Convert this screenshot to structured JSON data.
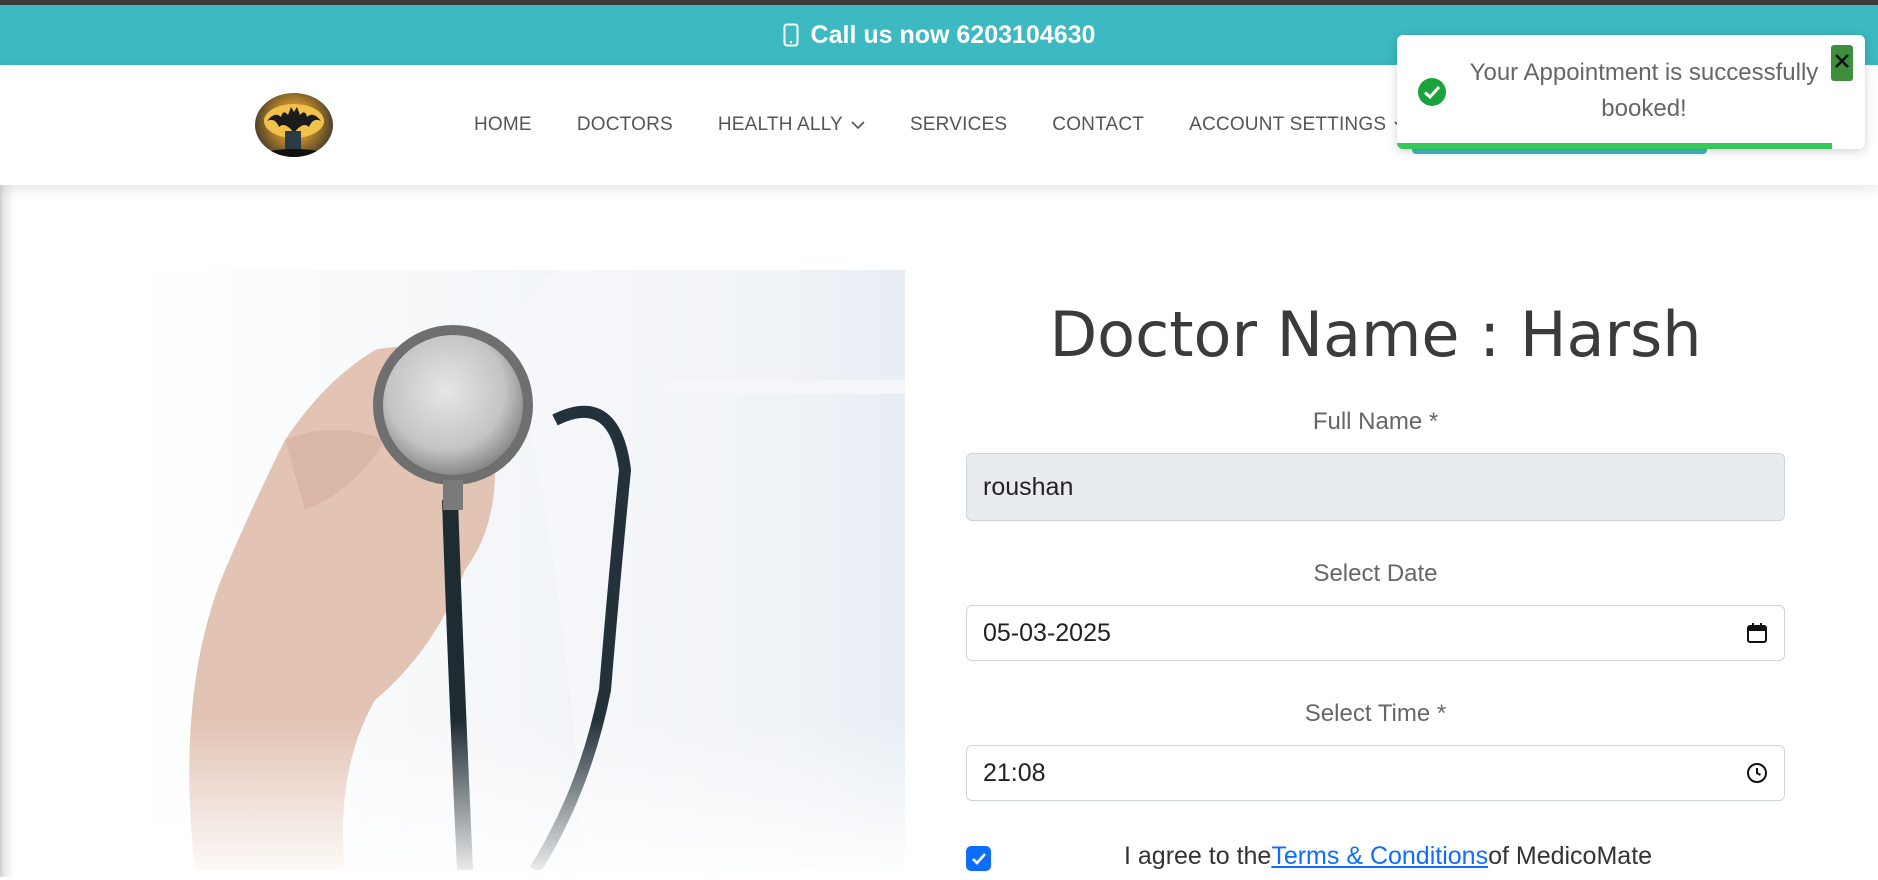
{
  "topbar": {
    "phone_text": "Call us now 6203104630"
  },
  "navbar": {
    "items": [
      {
        "label": "HOME"
      },
      {
        "label": "DOCTORS"
      },
      {
        "label": "HEALTH ALLY",
        "has_dropdown": true
      },
      {
        "label": "SERVICES"
      },
      {
        "label": "CONTACT"
      },
      {
        "label": "ACCOUNT SETTINGS",
        "has_dropdown": true
      }
    ]
  },
  "form": {
    "title": "Doctor Name : Harsh",
    "full_name_label": "Full Name *",
    "full_name_value": "roushan",
    "date_label": "Select Date",
    "date_value": "05-03-2025",
    "time_label": "Select Time *",
    "time_value": "21:08",
    "agree_prefix": "I agree to the",
    "agree_link": "Terms & Conditions",
    "agree_suffix": "of MedicoMate",
    "agree_checked": true
  },
  "toast": {
    "message": "Your Appointment is successfully booked!",
    "progress": 0.93,
    "status": "success"
  },
  "colors": {
    "topbar": "#3db9c1",
    "toast_progress": "#34c759",
    "checkbox": "#0d6efd",
    "close_button": "#3e8e3e"
  },
  "icons": {
    "topbar": "mobile-phone-icon",
    "dropdown": "chevron-down-icon",
    "date": "calendar-icon",
    "time": "clock-icon",
    "toast_status": "check-circle-icon",
    "toast_close": "close-icon"
  }
}
